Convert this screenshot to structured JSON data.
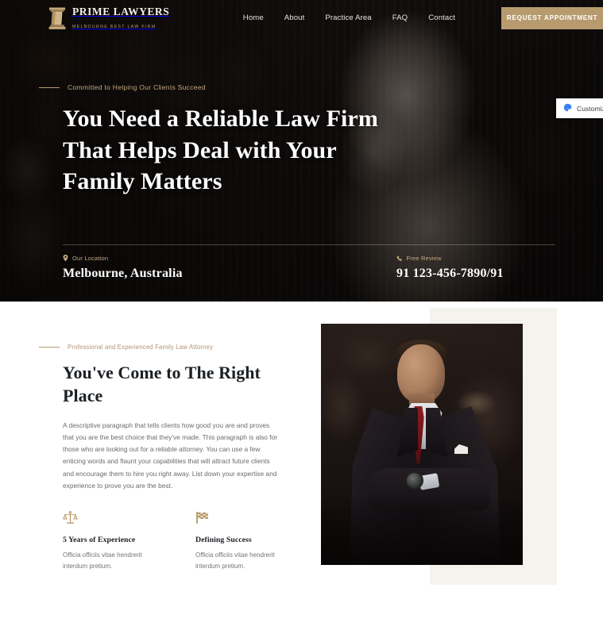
{
  "brand": {
    "name": "PRIME LAWYERS",
    "tagline": "MELBOURNE BEST LAW FIRM",
    "logo_icon": "column-pillar-icon"
  },
  "nav": {
    "items": [
      {
        "label": "Home"
      },
      {
        "label": "About"
      },
      {
        "label": "Practice Area"
      },
      {
        "label": "FAQ"
      },
      {
        "label": "Contact"
      }
    ],
    "cta_label": "REQUEST APPOINTMENT"
  },
  "hero": {
    "eyebrow": "Committed to Helping Our Clients Succeed",
    "title_line1": "You Need a Reliable Law Firm",
    "title_line2": "That Helps Deal with Your",
    "title_line3": "Family Matters",
    "location_label": "Our Location",
    "location_icon": "map-pin-icon",
    "location_value": "Melbourne, Australia",
    "phone_label": "Free Review",
    "phone_icon": "phone-icon",
    "phone_value": "91 123-456-7890/91"
  },
  "customize": {
    "label": "Customize",
    "icon": "palette-icon"
  },
  "about": {
    "eyebrow": "Professional and Experienced Family Law Attorney",
    "title_line1": "You've Come to The Right",
    "title_line2": "Place",
    "paragraph": "A descriptive paragraph that tells clients how good you are and proves that you are the best choice that they've made. This paragraph is also for those who are looking out for a reliable attorney. You can use a few enticing words and flaunt your capabilities that will attract future clients and encourage them to hire you right away. List down your expertise and experience to prove you are the best.",
    "features": [
      {
        "icon": "scales-of-justice-icon",
        "title": "5 Years of Experience",
        "desc": "Officia officiis vitae hendrerit interdum pretium."
      },
      {
        "icon": "checkered-flag-icon",
        "title": "Defining Success",
        "desc": "Officia officiis vitae hendrerit interdum pretium."
      }
    ],
    "portrait_alt": "Attorney portrait in dark suit with red tie"
  },
  "colors": {
    "accent_gold": "#b79b6e",
    "hero_bg_dark": "#100d0b",
    "heading_dark": "#1c2024",
    "body_gray": "#6b6b6b",
    "offset_block": "#f5f3ee"
  }
}
